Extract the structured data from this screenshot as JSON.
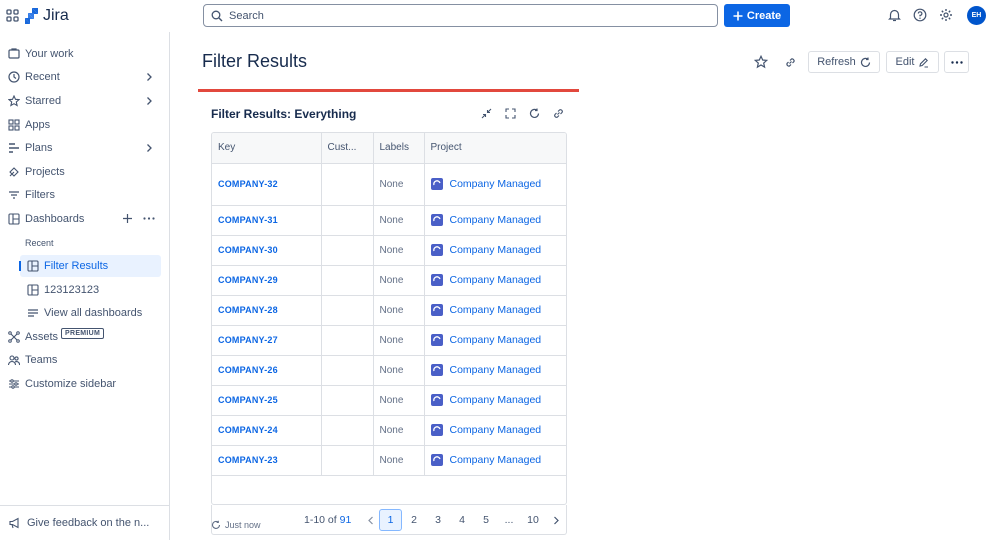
{
  "app": {
    "name": "Jira"
  },
  "search": {
    "placeholder": "Search"
  },
  "create_label": "Create",
  "user": {
    "initials": "EH"
  },
  "sidebar": {
    "items": [
      {
        "label": "Your work",
        "icon": "your-work-icon"
      },
      {
        "label": "Recent",
        "icon": "clock-icon",
        "chevron": true
      },
      {
        "label": "Starred",
        "icon": "star-icon",
        "chevron": true
      },
      {
        "label": "Apps",
        "icon": "apps-icon"
      },
      {
        "label": "Plans",
        "icon": "plans-icon",
        "chevron": true
      },
      {
        "label": "Projects",
        "icon": "projects-icon"
      },
      {
        "label": "Filters",
        "icon": "filter-icon"
      },
      {
        "label": "Dashboards",
        "icon": "dashboard-icon"
      }
    ],
    "recent_caption": "Recent",
    "dashboards": [
      {
        "label": "Filter Results",
        "selected": true
      },
      {
        "label": "123123123"
      },
      {
        "label": "View all dashboards"
      }
    ],
    "assets": {
      "label": "Assets",
      "badge": "PREMIUM"
    },
    "teams": "Teams",
    "customize": "Customize sidebar",
    "feedback": "Give feedback on the n..."
  },
  "page": {
    "title": "Filter Results",
    "refresh_label": "Refresh",
    "edit_label": "Edit"
  },
  "gadget": {
    "title": "Filter Results: Everything",
    "columns": [
      "Key",
      "Cust...",
      "Labels",
      "Project"
    ],
    "rows": [
      {
        "key": "COMPANY-32",
        "custom": "",
        "labels": "None",
        "project": "Company Managed"
      },
      {
        "key": "COMPANY-31",
        "custom": "",
        "labels": "None",
        "project": "Company Managed"
      },
      {
        "key": "COMPANY-30",
        "custom": "",
        "labels": "None",
        "project": "Company Managed"
      },
      {
        "key": "COMPANY-29",
        "custom": "",
        "labels": "None",
        "project": "Company Managed"
      },
      {
        "key": "COMPANY-28",
        "custom": "",
        "labels": "None",
        "project": "Company Managed"
      },
      {
        "key": "COMPANY-27",
        "custom": "",
        "labels": "None",
        "project": "Company Managed"
      },
      {
        "key": "COMPANY-26",
        "custom": "",
        "labels": "None",
        "project": "Company Managed"
      },
      {
        "key": "COMPANY-25",
        "custom": "",
        "labels": "None",
        "project": "Company Managed"
      },
      {
        "key": "COMPANY-24",
        "custom": "",
        "labels": "None",
        "project": "Company Managed"
      },
      {
        "key": "COMPANY-23",
        "custom": "",
        "labels": "None",
        "project": "Company Managed"
      }
    ],
    "pagination": {
      "range": "1-10 of",
      "total": "91",
      "pages": [
        "1",
        "2",
        "3",
        "4",
        "5",
        "...",
        "10"
      ],
      "current": "1"
    },
    "updated": "Just now"
  },
  "colors": {
    "accent": "#0c66e4",
    "gadget_border": "#e2483d"
  }
}
